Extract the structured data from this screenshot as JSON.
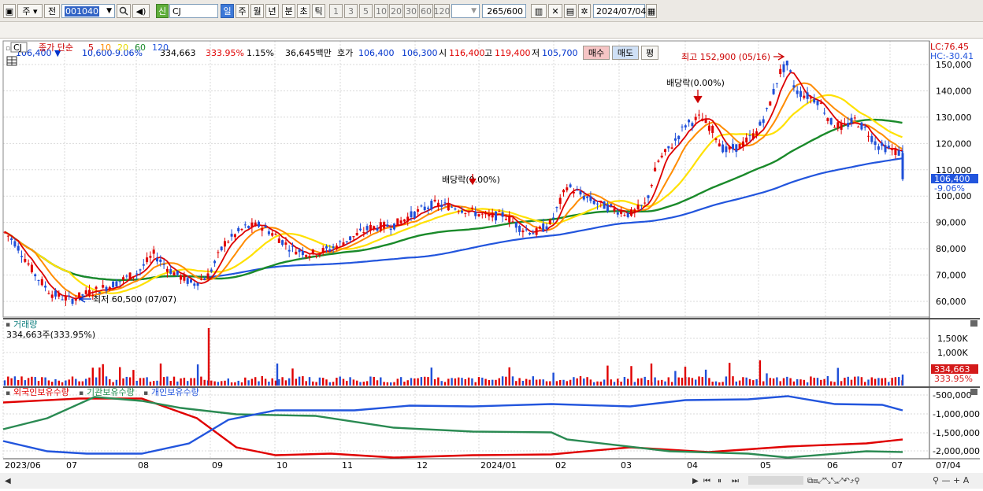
{
  "toolbar": {
    "window_icon": "window-icon",
    "period_type": "주",
    "prev_label": "전",
    "code": "001040",
    "search_icon": "search-icon",
    "speaker_icon": "speaker-icon",
    "credit_label": "신",
    "stock_name": "CJ",
    "periods": [
      "일",
      "주",
      "월",
      "년",
      "분",
      "초",
      "틱"
    ],
    "active_period": "일",
    "minute_options": [
      "1",
      "3",
      "5",
      "10",
      "20",
      "30",
      "60",
      "120"
    ],
    "count_display": "265",
    "count_total": "/600",
    "date": "2024/07/04"
  },
  "quote": {
    "price": "106,400",
    "change": "10,600",
    "change_pct": "-9.06%",
    "volume": "334,663",
    "volume_ratio": "333.95%",
    "turnover": "1.15%",
    "amount": "36,645백만",
    "ask_label": "호가",
    "ask": "106,400",
    "bid": "106,300",
    "open_label": "시",
    "open": "116,400",
    "high_label": "고",
    "high": "119,400",
    "low_label": "저",
    "low": "105,700",
    "buy_label": "매수",
    "sell_label": "매도",
    "eval_label": "평"
  },
  "price_panel": {
    "name_tag": "CJ",
    "legend": [
      {
        "label": "종가 단순",
        "color": "#cc0000"
      },
      {
        "label": "5",
        "color": "#cc0000"
      },
      {
        "label": "10",
        "color": "#ff8c00"
      },
      {
        "label": "20",
        "color": "#e6d800"
      },
      {
        "label": "60",
        "color": "#1a8a2a"
      },
      {
        "label": "120",
        "color": "#2255dd"
      }
    ],
    "lc": "LC:76.45",
    "hc": "HC:-30.41",
    "last_price_tag": "106,400",
    "last_pct_tag": "-9.06%",
    "annot_high": "최고 152,900 (05/16)",
    "annot_low": "최저 60,500 (07/07)",
    "annot_div1": "배당락(0.00%)",
    "annot_div2": "배당락(0.00%)",
    "y_ticks": [
      "150,000",
      "140,000",
      "130,000",
      "120,000",
      "110,000",
      "100,000",
      "90,000",
      "80,000",
      "70,000",
      "60,000"
    ]
  },
  "volume_panel": {
    "title": "거래량",
    "value": "334,663주(333.95%)",
    "y_ticks": [
      "1,500K",
      "1,000K"
    ],
    "last_tag": "334,663",
    "last_pct": "333.95%"
  },
  "holdings_panel": {
    "legend": [
      {
        "label": "외국인보유수량",
        "color": "#e00000"
      },
      {
        "label": "기관보유수량",
        "color": "#1a8a4a"
      },
      {
        "label": "개인보유수량",
        "color": "#2255dd"
      }
    ],
    "y_ticks": [
      "-500,000",
      "-1,000,000",
      "-1,500,000",
      "-2,000,000"
    ]
  },
  "x_axis": [
    "2023/06",
    "07",
    "08",
    "09",
    "10",
    "11",
    "12",
    "2024/01",
    "02",
    "03",
    "04",
    "05",
    "06",
    "07"
  ],
  "x_axis_right": "07/04",
  "colors": {
    "up": "#e00000",
    "down": "#1f4fd8",
    "ma5": "#dd0000",
    "ma10": "#ff8c00",
    "ma20": "#ffe100",
    "ma60": "#1a8a2a",
    "ma120": "#2255dd"
  }
}
